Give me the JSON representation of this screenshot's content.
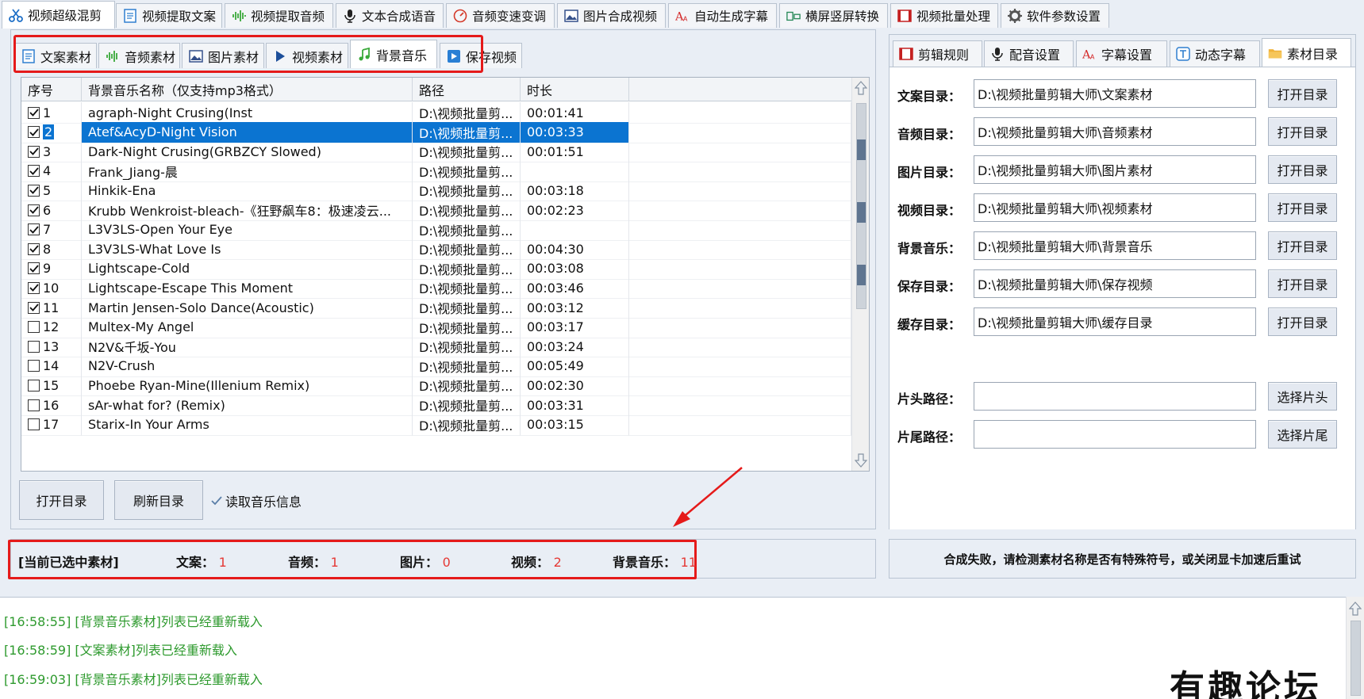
{
  "top_tabs": [
    {
      "label": "视频超级混剪",
      "icon": "scissors-icon",
      "active": true
    },
    {
      "label": "视频提取文案",
      "icon": "document-icon"
    },
    {
      "label": "视频提取音频",
      "icon": "audio-wave-icon"
    },
    {
      "label": "文本合成语音",
      "icon": "microphone-icon"
    },
    {
      "label": "音频变速变调",
      "icon": "speedometer-icon"
    },
    {
      "label": "图片合成视频",
      "icon": "image-icon"
    },
    {
      "label": "自动生成字幕",
      "icon": "font-size-icon"
    },
    {
      "label": "横屏竖屏转换",
      "icon": "rotate-screen-icon"
    },
    {
      "label": "视频批量处理",
      "icon": "film-icon"
    },
    {
      "label": "软件参数设置",
      "icon": "gear-icon"
    }
  ],
  "sub_tabs": [
    {
      "label": "文案素材",
      "icon": "document-icon"
    },
    {
      "label": "音频素材",
      "icon": "audio-wave-icon"
    },
    {
      "label": "图片素材",
      "icon": "image-icon"
    },
    {
      "label": "视频素材",
      "icon": "play-icon"
    },
    {
      "label": "背景音乐",
      "icon": "music-note-icon",
      "active": true
    },
    {
      "label": "保存视频",
      "icon": "save-video-icon"
    }
  ],
  "table": {
    "columns": [
      "序号",
      "背景音乐名称（仅支持mp3格式）",
      "路径",
      "时长"
    ],
    "rows": [
      {
        "no": "1",
        "name": "agraph-Night Crusing(Inst",
        "path": "D:\\视频批量剪...",
        "duration": "00:01:41",
        "checked": true
      },
      {
        "no": "2",
        "name": "Atef&AcyD-Night Vision",
        "path": "D:\\视频批量剪...",
        "duration": "00:03:33",
        "checked": true,
        "selected": true
      },
      {
        "no": "3",
        "name": "Dark-Night Crusing(GRBZCY Slowed)",
        "path": "D:\\视频批量剪...",
        "duration": "00:01:51",
        "checked": true
      },
      {
        "no": "4",
        "name": "Frank_Jiang-晨",
        "path": "D:\\视频批量剪...",
        "duration": "",
        "checked": true
      },
      {
        "no": "5",
        "name": "Hinkik-Ena",
        "path": "D:\\视频批量剪...",
        "duration": "00:03:18",
        "checked": true
      },
      {
        "no": "6",
        "name": "Krubb Wenkroist-bleach-《狂野飙车8：极速凌云...",
        "path": "D:\\视频批量剪...",
        "duration": "00:02:23",
        "checked": true
      },
      {
        "no": "7",
        "name": "L3V3LS-Open Your Eye",
        "path": "D:\\视频批量剪...",
        "duration": "",
        "checked": true
      },
      {
        "no": "8",
        "name": "L3V3LS-What Love Is",
        "path": "D:\\视频批量剪...",
        "duration": "00:04:30",
        "checked": true
      },
      {
        "no": "9",
        "name": "Lightscape-Cold",
        "path": "D:\\视频批量剪...",
        "duration": "00:03:08",
        "checked": true
      },
      {
        "no": "10",
        "name": "Lightscape-Escape This Moment",
        "path": "D:\\视频批量剪...",
        "duration": "00:03:46",
        "checked": true
      },
      {
        "no": "11",
        "name": "Martin Jensen-Solo Dance(Acoustic)",
        "path": "D:\\视频批量剪...",
        "duration": "00:03:12",
        "checked": true
      },
      {
        "no": "12",
        "name": "Multex-My Angel",
        "path": "D:\\视频批量剪...",
        "duration": "00:03:17",
        "checked": false
      },
      {
        "no": "13",
        "name": "N2V&千坂-You",
        "path": "D:\\视频批量剪...",
        "duration": "00:03:24",
        "checked": false
      },
      {
        "no": "14",
        "name": "N2V-Crush",
        "path": "D:\\视频批量剪...",
        "duration": "00:05:49",
        "checked": false
      },
      {
        "no": "15",
        "name": "Phoebe Ryan-Mine(Illenium Remix)",
        "path": "D:\\视频批量剪...",
        "duration": "00:02:30",
        "checked": false
      },
      {
        "no": "16",
        "name": "sAr-what for? (Remix)",
        "path": "D:\\视频批量剪...",
        "duration": "00:03:31",
        "checked": false
      },
      {
        "no": "17",
        "name": "Starix-In Your Arms",
        "path": "D:\\视频批量剪...",
        "duration": "00:03:15",
        "checked": false
      }
    ]
  },
  "left_buttons": {
    "open_dir": "打开目录",
    "refresh_dir": "刷新目录",
    "read_music_info": "读取音乐信息"
  },
  "selection_status": {
    "title": "[当前已选中素材]",
    "text_label": "文案：",
    "text_count": "1",
    "audio_label": "音频：",
    "audio_count": "1",
    "image_label": "图片：",
    "image_count": "0",
    "video_label": "视频：",
    "video_count": "2",
    "bgm_label": "背景音乐：",
    "bgm_count": "11"
  },
  "right_tabs": [
    {
      "label": "剪辑规则",
      "icon": "film-icon"
    },
    {
      "label": "配音设置",
      "icon": "microphone-icon"
    },
    {
      "label": "字幕设置",
      "icon": "font-size-icon"
    },
    {
      "label": "动态字幕",
      "icon": "text-box-icon"
    },
    {
      "label": "素材目录",
      "icon": "folder-icon",
      "active": true
    }
  ],
  "directories": [
    {
      "label": "文案目录：",
      "value": "D:\\视频批量剪辑大师\\文案素材",
      "button": "打开目录"
    },
    {
      "label": "音频目录：",
      "value": "D:\\视频批量剪辑大师\\音频素材",
      "button": "打开目录"
    },
    {
      "label": "图片目录：",
      "value": "D:\\视频批量剪辑大师\\图片素材",
      "button": "打开目录"
    },
    {
      "label": "视频目录：",
      "value": "D:\\视频批量剪辑大师\\视频素材",
      "button": "打开目录"
    },
    {
      "label": "背景音乐：",
      "value": "D:\\视频批量剪辑大师\\背景音乐",
      "button": "打开目录"
    },
    {
      "label": "保存目录：",
      "value": "D:\\视频批量剪辑大师\\保存视频",
      "button": "打开目录"
    },
    {
      "label": "缓存目录：",
      "value": "D:\\视频批量剪辑大师\\缓存目录",
      "button": "打开目录"
    }
  ],
  "clip_paths": [
    {
      "label": "片头路径：",
      "value": "",
      "button": "选择片头"
    },
    {
      "label": "片尾路径：",
      "value": "",
      "button": "选择片尾"
    }
  ],
  "right_status": "合成失败，请检测素材名称是否有特殊符号，或关闭显卡加速后重试",
  "log": [
    "[16:58:55] [背景音乐素材]列表已经重新载入",
    "[16:58:59] [文案素材]列表已经重新载入",
    "[16:59:03] [背景音乐素材]列表已经重新载入"
  ],
  "watermark": "有趣论坛",
  "colors": {
    "accent": "#0b74d1",
    "highlight": "#e51a1a",
    "count": "#e53935",
    "log": "#2e9a2e"
  }
}
